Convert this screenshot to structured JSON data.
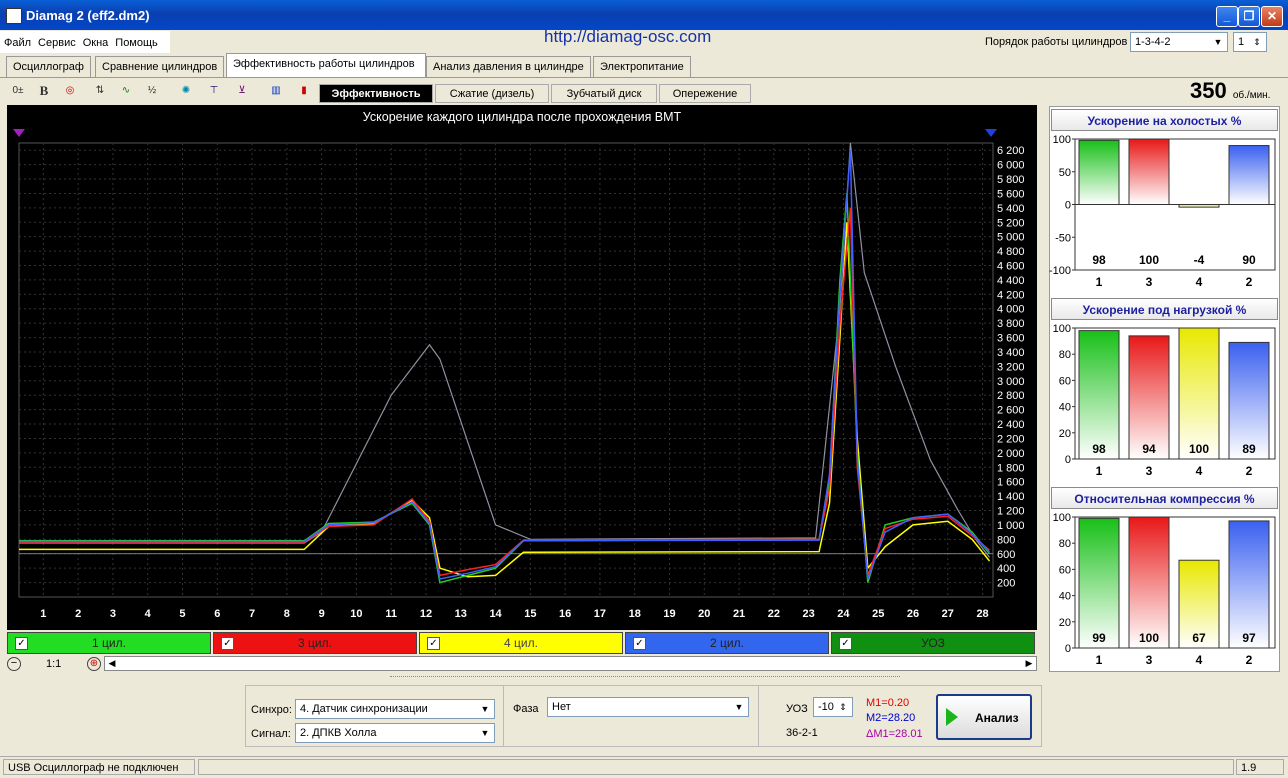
{
  "window": {
    "title": "Diamag 2 (eff2.dm2)"
  },
  "menu": [
    "Файл",
    "Сервис",
    "Окна",
    "Помощь"
  ],
  "url": "http://diamag-osc.com",
  "order": {
    "label": "Порядок работы цилиндров",
    "value": "1-3-4-2",
    "index": "1"
  },
  "tabs": [
    "Осциллограф",
    "Сравнение цилиндров",
    "Эффективность работы цилиндров",
    "Анализ давления в цилиндре",
    "Электропитание"
  ],
  "subtabs": [
    "Эффективность",
    "Сжатие (дизель)",
    "Зубчатый диск",
    "Опережение"
  ],
  "toolbar_icons": [
    "cursor-step-icon",
    "bold-icon",
    "rpm-icon",
    "scale-icon",
    "curve-icon",
    "alg-icon",
    "sensor-icon",
    "teeth-icon",
    "filter-icon",
    "bars-icon",
    "cylinder-icon"
  ],
  "rpm": {
    "value": "350",
    "unit": "об./мин."
  },
  "chart_data": {
    "type": "line",
    "title": "Ускорение каждого цилиндра после прохождения ВМТ",
    "x_ticks": [
      "1",
      "2",
      "3",
      "4",
      "5",
      "6",
      "7",
      "8",
      "9",
      "10",
      "11",
      "12",
      "13",
      "14",
      "15",
      "16",
      "17",
      "18",
      "19",
      "20",
      "21",
      "22",
      "23",
      "24",
      "25",
      "26",
      "27",
      "28"
    ],
    "y_ticks": [
      "200",
      "400",
      "600",
      "800",
      "1 000",
      "1 200",
      "1 400",
      "1 600",
      "1 800",
      "2 000",
      "2 200",
      "2 400",
      "2 600",
      "2 800",
      "3 000",
      "3 200",
      "3 400",
      "3 600",
      "3 800",
      "4 000",
      "4 200",
      "4 400",
      "4 600",
      "4 800",
      "5 000",
      "5 200",
      "5 400",
      "5 600",
      "5 800",
      "6 000",
      "6 200"
    ],
    "xlim": [
      0.3,
      28.3
    ],
    "ylim": [
      0,
      6300
    ],
    "series": [
      {
        "name": "1 цил.",
        "color": "#20d020",
        "points": [
          [
            0.3,
            780
          ],
          [
            8.5,
            780
          ],
          [
            9.2,
            1020
          ],
          [
            10.5,
            1040
          ],
          [
            11.6,
            1300
          ],
          [
            12.1,
            1000
          ],
          [
            12.4,
            200
          ],
          [
            13.2,
            300
          ],
          [
            14,
            400
          ],
          [
            14.8,
            780
          ],
          [
            23.3,
            800
          ],
          [
            23.6,
            1600
          ],
          [
            23.9,
            4400
          ],
          [
            24.1,
            5600
          ],
          [
            24.4,
            2000
          ],
          [
            24.7,
            200
          ],
          [
            25.2,
            1000
          ],
          [
            26,
            1100
          ],
          [
            27,
            1150
          ],
          [
            27.7,
            900
          ],
          [
            28.2,
            600
          ]
        ]
      },
      {
        "name": "3 цил.",
        "color": "#ff2020",
        "points": [
          [
            0.3,
            760
          ],
          [
            8.5,
            760
          ],
          [
            9.2,
            980
          ],
          [
            10.5,
            1000
          ],
          [
            11.6,
            1360
          ],
          [
            12.1,
            1050
          ],
          [
            12.4,
            300
          ],
          [
            13.2,
            380
          ],
          [
            14,
            450
          ],
          [
            14.8,
            790
          ],
          [
            23.3,
            800
          ],
          [
            23.6,
            1500
          ],
          [
            23.9,
            3800
          ],
          [
            24.2,
            5400
          ],
          [
            24.4,
            1800
          ],
          [
            24.7,
            300
          ],
          [
            25.2,
            950
          ],
          [
            26,
            1080
          ],
          [
            27,
            1120
          ],
          [
            27.7,
            850
          ],
          [
            28.2,
            650
          ]
        ]
      },
      {
        "name": "4 цил.",
        "color": "#ffff00",
        "points": [
          [
            0.3,
            660
          ],
          [
            8.5,
            660
          ],
          [
            9.2,
            980
          ],
          [
            10.5,
            1020
          ],
          [
            11.6,
            1340
          ],
          [
            12.1,
            1100
          ],
          [
            12.4,
            400
          ],
          [
            13.2,
            280
          ],
          [
            14,
            300
          ],
          [
            14.8,
            620
          ],
          [
            23.3,
            630
          ],
          [
            23.6,
            1300
          ],
          [
            23.9,
            3600
          ],
          [
            24.1,
            5200
          ],
          [
            24.4,
            2200
          ],
          [
            24.7,
            400
          ],
          [
            25.2,
            700
          ],
          [
            26,
            1000
          ],
          [
            27,
            1050
          ],
          [
            27.7,
            800
          ],
          [
            28.2,
            500
          ]
        ]
      },
      {
        "name": "2 цил.",
        "color": "#4060ff",
        "points": [
          [
            0.3,
            770
          ],
          [
            8.5,
            770
          ],
          [
            9.2,
            1000
          ],
          [
            10.5,
            1030
          ],
          [
            11.6,
            1320
          ],
          [
            12.1,
            1020
          ],
          [
            12.4,
            250
          ],
          [
            13.2,
            330
          ],
          [
            14,
            420
          ],
          [
            14.8,
            780
          ],
          [
            23.3,
            790
          ],
          [
            23.6,
            1700
          ],
          [
            23.9,
            4200
          ],
          [
            24.2,
            6200
          ],
          [
            24.4,
            1900
          ],
          [
            24.7,
            250
          ],
          [
            25.2,
            900
          ],
          [
            26,
            1100
          ],
          [
            27,
            1150
          ],
          [
            27.7,
            880
          ],
          [
            28.2,
            620
          ]
        ]
      },
      {
        "name": "УОЗ",
        "color": "#9090a0",
        "points": [
          [
            0.3,
            750
          ],
          [
            8.5,
            750
          ],
          [
            9,
            900
          ],
          [
            11,
            2800
          ],
          [
            12.1,
            3500
          ],
          [
            12.4,
            3300
          ],
          [
            14,
            1000
          ],
          [
            15,
            800
          ],
          [
            23.2,
            820
          ],
          [
            23.9,
            4000
          ],
          [
            24.2,
            6300
          ],
          [
            24.6,
            4500
          ],
          [
            25.5,
            3200
          ],
          [
            26.5,
            1900
          ],
          [
            27.3,
            1200
          ],
          [
            27.8,
            800
          ],
          [
            28.2,
            550
          ]
        ]
      }
    ],
    "hline": 600,
    "grid": true
  },
  "legend": [
    "1 цил.",
    "3 цил.",
    "4 цил.",
    "2 цил.",
    "УОЗ"
  ],
  "legend_colors": [
    "#22dd22",
    "#ee1111",
    "#ffff00",
    "#3366ee",
    "#109010"
  ],
  "zoom": "1:1",
  "right_charts": [
    {
      "title": "Ускорение на холостых %",
      "type": "bar",
      "categories": [
        "1",
        "3",
        "4",
        "2"
      ],
      "values": [
        98,
        100,
        -4,
        90
      ],
      "ylim": [
        -100,
        100
      ],
      "yticks": [
        "100",
        "50",
        "0",
        "-50",
        "-100"
      ]
    },
    {
      "title": "Ускорение под нагрузкой %",
      "type": "bar",
      "categories": [
        "1",
        "3",
        "4",
        "2"
      ],
      "values": [
        98,
        94,
        100,
        89
      ],
      "ylim": [
        0,
        100
      ],
      "yticks": [
        "100",
        "80",
        "60",
        "40",
        "20",
        "0"
      ]
    },
    {
      "title": "Относительная компрессия %",
      "type": "bar",
      "categories": [
        "1",
        "3",
        "4",
        "2"
      ],
      "values": [
        99,
        100,
        67,
        97
      ],
      "ylim": [
        0,
        100
      ],
      "yticks": [
        "100",
        "80",
        "60",
        "40",
        "20",
        "0"
      ]
    }
  ],
  "bar_colors": [
    "#18c018",
    "#e81818",
    "#e8e800",
    "#3a60f0"
  ],
  "controls": {
    "sync_label": "Синхро:",
    "sync_value": "4.  Датчик синхронизации",
    "signal_label": "Сигнал:",
    "signal_value": "2.  ДПКВ Холла",
    "phase_label": "Фаза",
    "phase_value": "Нет",
    "uoz_label": "УОЗ",
    "uoz_value": "-10",
    "disk": "36-2-1",
    "m1": "M1=0.20",
    "m2": "M2=28.20",
    "dm": "ΔM1=28.01",
    "analyze": "Анализ"
  },
  "status": {
    "text": "USB Осциллограф не подключен",
    "version": "1.9"
  }
}
